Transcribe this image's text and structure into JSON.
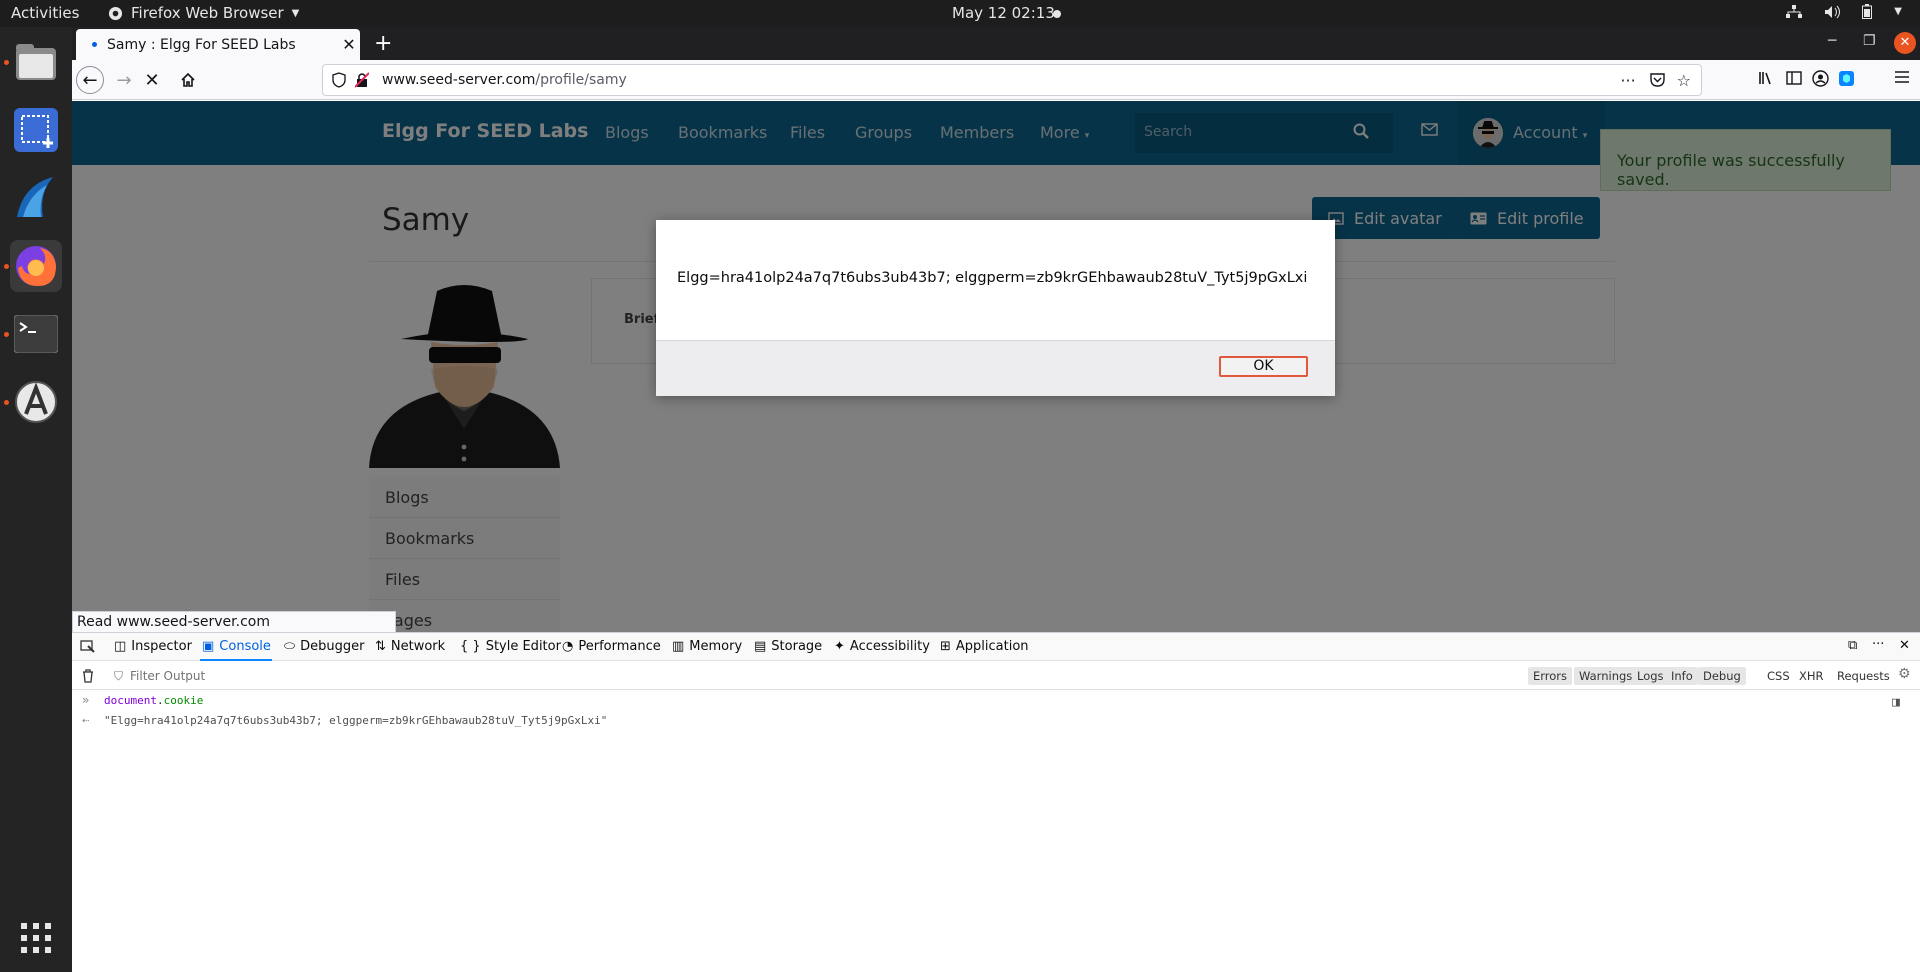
{
  "system": {
    "activities": "Activities",
    "app_name": "Firefox Web Browser",
    "clock": "May 12  02:13"
  },
  "browser": {
    "tab_title": "Samy : Elgg For SEED Labs",
    "url_host": "www.seed-server.com",
    "url_path": "/profile/samy"
  },
  "site": {
    "brand": "Elgg For SEED Labs",
    "nav": [
      "Blogs",
      "Bookmarks",
      "Files",
      "Groups",
      "Members",
      "More"
    ],
    "search_placeholder": "Search",
    "account_label": "Account",
    "success_message": "Your profile was successfully saved.",
    "profile_name": "Samy",
    "edit_avatar": "Edit avatar",
    "edit_profile": "Edit profile",
    "brief_label": "Brief",
    "side_menu": [
      "Blogs",
      "Bookmarks",
      "Files",
      "Pages"
    ]
  },
  "alert": {
    "message": "Elgg=hra41olp24a7q7t6ubs3ub43b7; elggperm=zb9krGEhbawaub28tuV_Tyt5j9pGxLxi",
    "ok_label": "OK"
  },
  "status_bar": "Read www.seed-server.com",
  "devtools": {
    "tabs": [
      "Inspector",
      "Console",
      "Debugger",
      "Network",
      "Style Editor",
      "Performance",
      "Memory",
      "Storage",
      "Accessibility",
      "Application"
    ],
    "filter_placeholder": "Filter Output",
    "filters": [
      "Errors",
      "Warnings",
      "Logs",
      "Info",
      "Debug",
      "CSS",
      "XHR",
      "Requests"
    ],
    "console_input_obj": "document",
    "console_input_dot": ".",
    "console_input_prop": "cookie",
    "console_output": "\"Elgg=hra41olp24a7q7t6ubs3ub43b7; elggperm=zb9krGEhbawaub28tuV_Tyt5j9pGxLxi\""
  }
}
